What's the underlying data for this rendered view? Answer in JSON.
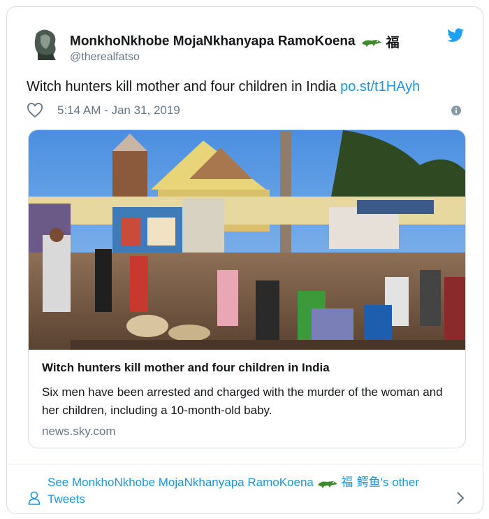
{
  "tweet": {
    "display_name": "MonkhoNkhobe MojaNkhanyapa RamoKoena",
    "name_badge_glyph": "福",
    "handle": "@therealfatso",
    "text": "Witch hunters kill mother and four children in India",
    "link_text": "po.st/t1HAyh",
    "timestamp": "5:14 AM - Jan 31, 2019"
  },
  "link_card": {
    "title": "Witch hunters kill mother and four children in India",
    "description": "Six men have been arrested and charged with the murder of the woman and her children, including a 10-month-old baby.",
    "domain": "news.sky.com"
  },
  "footer": {
    "prefix": "See MonkhoNkhobe MojaNkhanyapa RamoKoena",
    "glyphs": "福 鳄鱼",
    "suffix": "'s other Tweets"
  },
  "colors": {
    "link": "#1b95e0",
    "text": "#14171a",
    "muted": "#657786",
    "border": "#d7dde2"
  },
  "icons": [
    "avatar",
    "crocodile-emoji",
    "twitter-bird-icon",
    "heart-icon",
    "info-icon",
    "user-icon",
    "chevron-right-icon"
  ]
}
